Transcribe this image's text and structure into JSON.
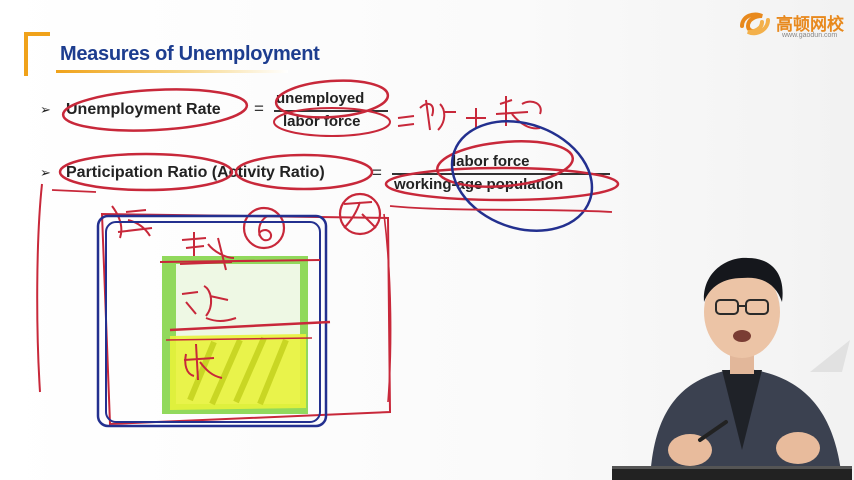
{
  "slide": {
    "title": "Measures of Unemployment",
    "bullet_symbol": "➢",
    "formula1": {
      "label": "Unemployment Rate",
      "equals": "=",
      "numerator": "unemployed",
      "denominator": "labor force"
    },
    "formula2": {
      "label": "Participation Ratio (Activity Ratio)",
      "equals": "=",
      "numerator": "labor force",
      "denominator": "working-age population"
    }
  },
  "logo": {
    "name": "高顿网校",
    "url": "www.gaodun.com",
    "icon": "gaodun-swirl-icon",
    "color": "#e8891d"
  },
  "annotations": {
    "handwriting_formula": "就 + 失",
    "diagram_top_marks": [
      "总",
      "6",
      "不"
    ],
    "box_labels": [
      "劳动",
      "就",
      "失"
    ],
    "ink_color": "#c8283a",
    "blue_ink_color": "#23308f",
    "green_fill": "#7ed23f",
    "yellow_fill": "#e8f23a"
  },
  "presenter": {
    "icon": "presenter-figure"
  }
}
